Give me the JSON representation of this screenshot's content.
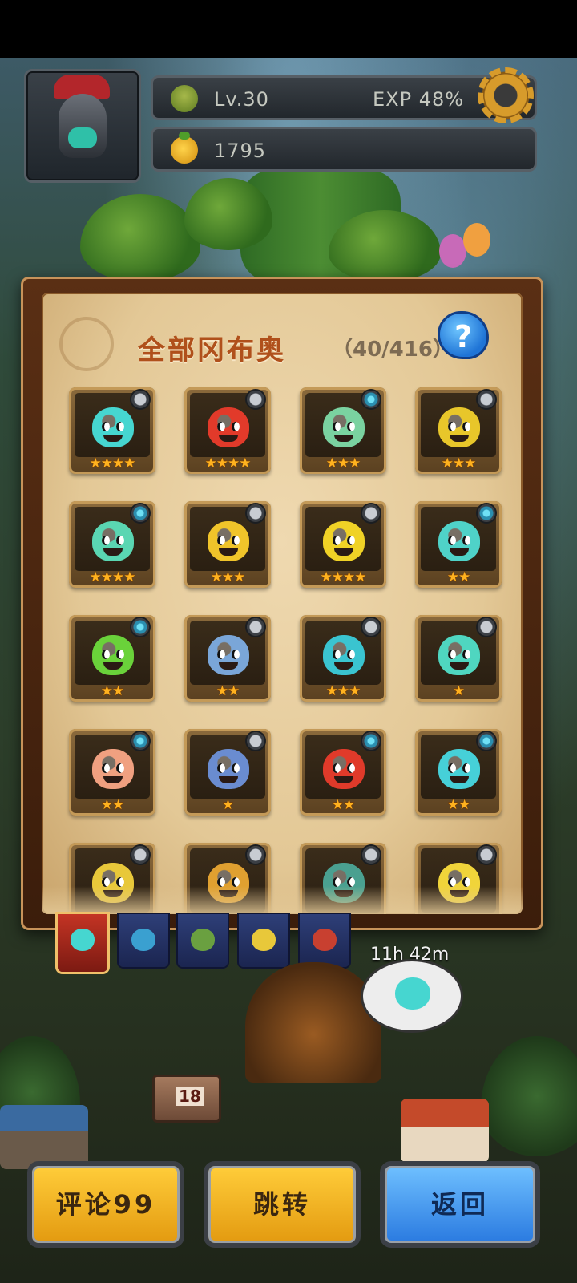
{
  "player": {
    "level_label": "Lv.30",
    "exp_label": "EXP 48%",
    "exp_percent": 48,
    "currency_value": "1795"
  },
  "collection": {
    "title": "全部冈布奥",
    "count_label": "（40/416）",
    "help_label": "?",
    "creatures": [
      {
        "color": "#46d6d0",
        "badge": "sword",
        "stars": "★★★★"
      },
      {
        "color": "#e23a2a",
        "badge": "sword",
        "stars": "★★★★"
      },
      {
        "color": "#7ad2a0",
        "badge": "swirl",
        "stars": "★★★"
      },
      {
        "color": "#e8c62a",
        "badge": "sword",
        "stars": "★★★"
      },
      {
        "color": "#5ad6b2",
        "badge": "swirl",
        "stars": "★★★★"
      },
      {
        "color": "#f0c42a",
        "badge": "sword",
        "stars": "★★★"
      },
      {
        "color": "#f0d226",
        "badge": "sword",
        "stars": "★★★★"
      },
      {
        "color": "#4fd2c8",
        "badge": "swirl",
        "stars": "★★"
      },
      {
        "color": "#6ad23a",
        "badge": "swirl",
        "stars": "★★"
      },
      {
        "color": "#7aa6d8",
        "badge": "sword",
        "stars": "★★"
      },
      {
        "color": "#3ac4d0",
        "badge": "sword",
        "stars": "★★★"
      },
      {
        "color": "#4fd6c0",
        "badge": "sword",
        "stars": "★"
      },
      {
        "color": "#f0a080",
        "badge": "swirl",
        "stars": "★★"
      },
      {
        "color": "#6a8cd0",
        "badge": "sword",
        "stars": "★"
      },
      {
        "color": "#e03a2a",
        "badge": "swirl",
        "stars": "★★"
      },
      {
        "color": "#46d0d8",
        "badge": "swirl",
        "stars": "★★"
      },
      {
        "color": "#e8c83a",
        "badge": "sword",
        "stars": ""
      },
      {
        "color": "#e0a030",
        "badge": "sword",
        "stars": ""
      },
      {
        "color": "#4aa090",
        "badge": "sword",
        "stars": ""
      },
      {
        "color": "#f0d43a",
        "badge": "sword",
        "stars": ""
      }
    ]
  },
  "tabs": [
    {
      "name": "all",
      "color": "#46d6d0"
    },
    {
      "name": "water",
      "color": "#3aa0d0"
    },
    {
      "name": "nature",
      "color": "#6aa040"
    },
    {
      "name": "light",
      "color": "#e8c83a"
    },
    {
      "name": "dark",
      "color": "#c84030"
    }
  ],
  "scene": {
    "timer_label": "11h 42m",
    "sign_number": "18"
  },
  "buttons": {
    "comment_label": "评论99",
    "jump_label": "跳转",
    "back_label": "返回"
  },
  "colors": {
    "title": "#b0501b",
    "star": "#ffb21f",
    "gold_button": "#ffcd3a",
    "blue_button": "#2a7ae0"
  }
}
